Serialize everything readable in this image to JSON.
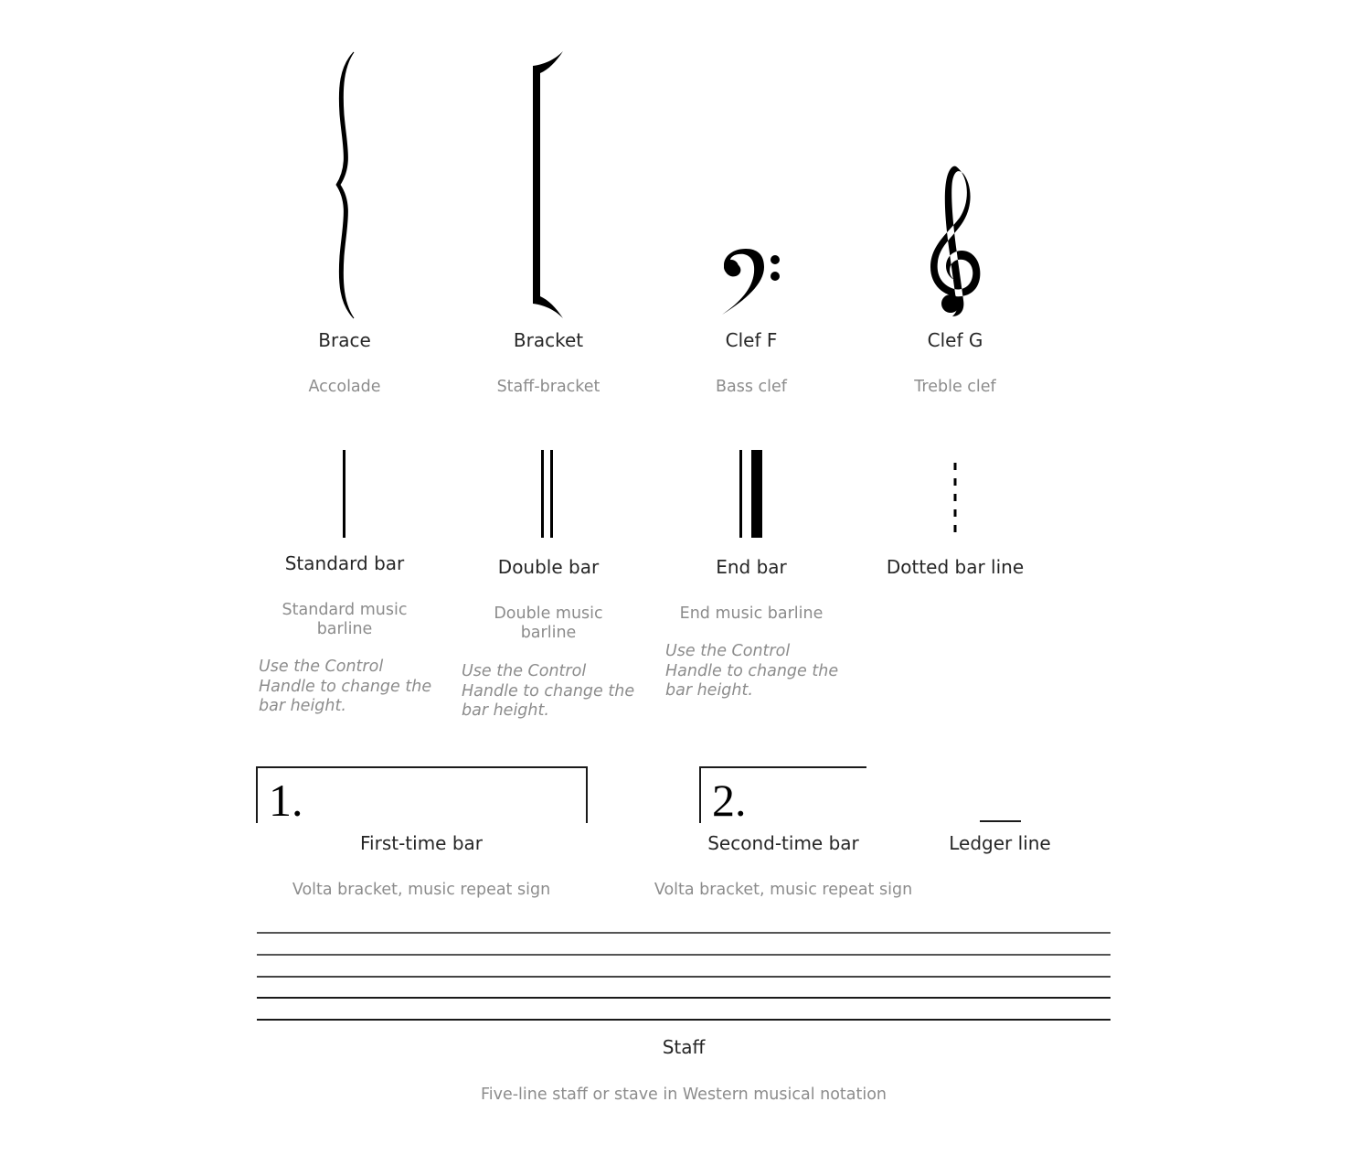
{
  "symbols": {
    "brace": {
      "title": "Brace",
      "subtitle": "Accolade"
    },
    "bracket": {
      "title": "Bracket",
      "subtitle": "Staff-bracket"
    },
    "clef_f": {
      "title": "Clef F",
      "subtitle": "Bass clef"
    },
    "clef_g": {
      "title": "Clef G",
      "subtitle": "Treble clef"
    },
    "standard_bar": {
      "title": "Standard bar",
      "subtitle": "Standard music barline",
      "note": "Use the Control Handle to change the bar height."
    },
    "double_bar": {
      "title": "Double bar",
      "subtitle": "Double music barline",
      "note": "Use the Control Handle to change the bar height."
    },
    "end_bar": {
      "title": "End bar",
      "subtitle": "End music barline",
      "note": "Use the Control Handle to change the bar height."
    },
    "dotted_bar": {
      "title": "Dotted bar line"
    },
    "first_time_bar": {
      "title": "First-time bar",
      "subtitle": "Volta bracket, music repeat sign",
      "number": "1."
    },
    "second_time_bar": {
      "title": "Second-time bar",
      "subtitle": "Volta bracket, music repeat sign",
      "number": "2."
    },
    "ledger_line": {
      "title": "Ledger line"
    },
    "staff": {
      "title": "Staff",
      "subtitle": "Five-line staff or stave in Western musical notation"
    }
  },
  "colors": {
    "title_text": "#262626",
    "subtitle_text": "#8c8c8c",
    "glyph": "#000000"
  }
}
